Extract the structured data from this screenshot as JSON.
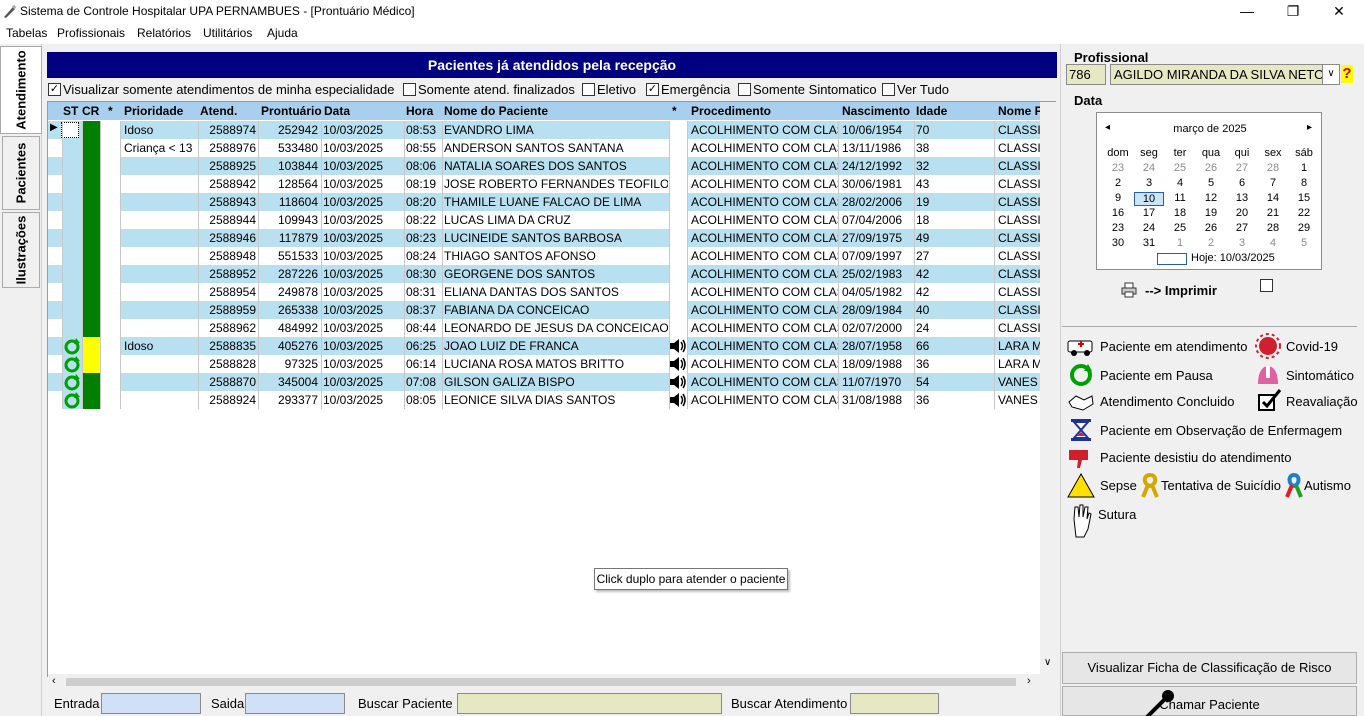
{
  "window": {
    "title": "Sistema de Controle Hospitalar UPA PERNAMBUES - [Prontuário Médico]",
    "controls": {
      "minimize": "—",
      "maximize": "❐",
      "close": "✕"
    }
  },
  "menu": [
    "Tabelas",
    "Profissionais",
    "Relatórios",
    "Utilitários",
    "Ajuda"
  ],
  "side_tabs": [
    "Atendimento",
    "Pacientes",
    "Ilustrações"
  ],
  "panel_title": "Pacientes já atendidos pela recepção",
  "filters": [
    {
      "label": "Visualizar somente atendimentos de minha especialidade",
      "checked": true
    },
    {
      "label": "Somente atend. finalizados",
      "checked": false
    },
    {
      "label": "Eletivo",
      "checked": false
    },
    {
      "label": "Emergência",
      "checked": true
    },
    {
      "label": "Somente Sintomatico",
      "checked": false
    },
    {
      "label": "Ver Tudo",
      "checked": false
    }
  ],
  "columns": [
    "ST",
    "CR",
    "*",
    "Prioridade",
    "Atend.",
    "Prontuário",
    "Data",
    "Hora",
    "Nome do Paciente",
    "*",
    "Procedimento",
    "Nascimento",
    "Idade",
    "Nome P"
  ],
  "rows": [
    {
      "st": "",
      "cr": "green",
      "prioridade": "Idoso",
      "atend": "2588974",
      "prontuario": "252942",
      "data": "10/03/2025",
      "hora": "08:53",
      "nome": "EVANDRO LIMA",
      "audio": false,
      "procedimento": "ACOLHIMENTO COM CLAS",
      "nascimento": "10/06/1954",
      "idade": "70",
      "prof": "CLASSI",
      "selected": true
    },
    {
      "st": "",
      "cr": "green",
      "prioridade": "Criança < 13",
      "atend": "2588976",
      "prontuario": "533480",
      "data": "10/03/2025",
      "hora": "08:55",
      "nome": "ANDERSON SANTOS SANTANA",
      "audio": false,
      "procedimento": "ACOLHIMENTO COM CLAS",
      "nascimento": "13/11/1986",
      "idade": "38",
      "prof": "CLASSI"
    },
    {
      "st": "",
      "cr": "green",
      "prioridade": "",
      "atend": "2588925",
      "prontuario": "103844",
      "data": "10/03/2025",
      "hora": "08:06",
      "nome": "NATALIA SOARES DOS SANTOS",
      "audio": false,
      "procedimento": "ACOLHIMENTO COM CLAS",
      "nascimento": "24/12/1992",
      "idade": "32",
      "prof": "CLASSI"
    },
    {
      "st": "",
      "cr": "green",
      "prioridade": "",
      "atend": "2588942",
      "prontuario": "128564",
      "data": "10/03/2025",
      "hora": "08:19",
      "nome": "JOSE ROBERTO FERNANDES TEOFILO",
      "audio": false,
      "procedimento": "ACOLHIMENTO COM CLAS",
      "nascimento": "30/06/1981",
      "idade": "43",
      "prof": "CLASSI"
    },
    {
      "st": "",
      "cr": "green",
      "prioridade": "",
      "atend": "2588943",
      "prontuario": "118604",
      "data": "10/03/2025",
      "hora": "08:20",
      "nome": "THAMILE LUANE FALCAO DE LIMA",
      "audio": false,
      "procedimento": "ACOLHIMENTO COM CLAS",
      "nascimento": "28/02/2006",
      "idade": "19",
      "prof": "CLASSI"
    },
    {
      "st": "",
      "cr": "green",
      "prioridade": "",
      "atend": "2588944",
      "prontuario": "109943",
      "data": "10/03/2025",
      "hora": "08:22",
      "nome": "LUCAS LIMA DA CRUZ",
      "audio": false,
      "procedimento": "ACOLHIMENTO COM CLAS",
      "nascimento": "07/04/2006",
      "idade": "18",
      "prof": "CLASSI"
    },
    {
      "st": "",
      "cr": "green",
      "prioridade": "",
      "atend": "2588946",
      "prontuario": "117879",
      "data": "10/03/2025",
      "hora": "08:23",
      "nome": "LUCINEIDE SANTOS BARBOSA",
      "audio": false,
      "procedimento": "ACOLHIMENTO COM CLAS",
      "nascimento": "27/09/1975",
      "idade": "49",
      "prof": "CLASSI"
    },
    {
      "st": "",
      "cr": "green",
      "prioridade": "",
      "atend": "2588948",
      "prontuario": "551533",
      "data": "10/03/2025",
      "hora": "08:24",
      "nome": "THIAGO SANTOS AFONSO",
      "audio": false,
      "procedimento": "ACOLHIMENTO COM CLAS",
      "nascimento": "07/09/1997",
      "idade": "27",
      "prof": "CLASSI"
    },
    {
      "st": "",
      "cr": "green",
      "prioridade": "",
      "atend": "2588952",
      "prontuario": "287226",
      "data": "10/03/2025",
      "hora": "08:30",
      "nome": "GEORGENE DOS SANTOS",
      "audio": false,
      "procedimento": "ACOLHIMENTO COM CLAS",
      "nascimento": "25/02/1983",
      "idade": "42",
      "prof": "CLASSI"
    },
    {
      "st": "",
      "cr": "green",
      "prioridade": "",
      "atend": "2588954",
      "prontuario": "249878",
      "data": "10/03/2025",
      "hora": "08:31",
      "nome": "ELIANA DANTAS DOS SANTOS",
      "audio": false,
      "procedimento": "ACOLHIMENTO COM CLAS",
      "nascimento": "04/05/1982",
      "idade": "42",
      "prof": "CLASSI"
    },
    {
      "st": "",
      "cr": "green",
      "prioridade": "",
      "atend": "2588959",
      "prontuario": "265338",
      "data": "10/03/2025",
      "hora": "08:37",
      "nome": "FABIANA DA CONCEICAO",
      "audio": false,
      "procedimento": "ACOLHIMENTO COM CLAS",
      "nascimento": "28/09/1984",
      "idade": "40",
      "prof": "CLASSI"
    },
    {
      "st": "",
      "cr": "green",
      "prioridade": "",
      "atend": "2588962",
      "prontuario": "484992",
      "data": "10/03/2025",
      "hora": "08:44",
      "nome": "LEONARDO DE JESUS DA CONCEICAO",
      "audio": false,
      "procedimento": "ACOLHIMENTO COM CLAS",
      "nascimento": "02/07/2000",
      "idade": "24",
      "prof": "CLASSI"
    },
    {
      "st": "pause",
      "cr": "yellow",
      "prioridade": "Idoso",
      "atend": "2588835",
      "prontuario": "405276",
      "data": "10/03/2025",
      "hora": "06:25",
      "nome": "JOAO LUIZ DE FRANCA",
      "audio": true,
      "procedimento": "ACOLHIMENTO COM CLAS",
      "nascimento": "28/07/1958",
      "idade": "66",
      "prof": "LARA M"
    },
    {
      "st": "pause",
      "cr": "yellow",
      "prioridade": "",
      "atend": "2588828",
      "prontuario": "97325",
      "data": "10/03/2025",
      "hora": "06:14",
      "nome": "LUCIANA ROSA MATOS BRITTO",
      "audio": true,
      "procedimento": "ACOLHIMENTO COM CLAS",
      "nascimento": "18/09/1988",
      "idade": "36",
      "prof": "LARA M"
    },
    {
      "st": "pause",
      "cr": "green",
      "prioridade": "",
      "atend": "2588870",
      "prontuario": "345004",
      "data": "10/03/2025",
      "hora": "07:08",
      "nome": "GILSON GALIZA BISPO",
      "audio": true,
      "procedimento": "ACOLHIMENTO COM CLAS",
      "nascimento": "11/07/1970",
      "idade": "54",
      "prof": "VANES"
    },
    {
      "st": "pause",
      "cr": "green",
      "prioridade": "",
      "atend": "2588924",
      "prontuario": "293377",
      "data": "10/03/2025",
      "hora": "08:05",
      "nome": "LEONICE SILVA DIAS SANTOS",
      "audio": true,
      "procedimento": "ACOLHIMENTO COM CLAS",
      "nascimento": "31/08/1988",
      "idade": "36",
      "prof": "VANES"
    }
  ],
  "tooltip": "Click duplo para atender o paciente",
  "bottom": {
    "entrada_label": "Entrada",
    "saida_label": "Saida",
    "buscar_paciente_label": "Buscar Paciente",
    "buscar_atendimento_label": "Buscar Atendimento"
  },
  "profissional": {
    "label": "Profissional",
    "code": "786",
    "name": "AGILDO MIRANDA DA SILVA NETO",
    "help": "?"
  },
  "data_label": "Data",
  "calendar": {
    "month": "março de 2025",
    "weekdays": [
      "dom",
      "seg",
      "ter",
      "qua",
      "qui",
      "sex",
      "sáb"
    ],
    "days": [
      [
        "23",
        "24",
        "25",
        "26",
        "27",
        "28",
        "1"
      ],
      [
        "2",
        "3",
        "4",
        "5",
        "6",
        "7",
        "8"
      ],
      [
        "9",
        "10",
        "11",
        "12",
        "13",
        "14",
        "15"
      ],
      [
        "16",
        "17",
        "18",
        "19",
        "20",
        "21",
        "22"
      ],
      [
        "23",
        "24",
        "25",
        "26",
        "27",
        "28",
        "29"
      ],
      [
        "30",
        "31",
        "1",
        "2",
        "3",
        "4",
        "5"
      ]
    ],
    "selected": "10",
    "today_label": "Hoje: 10/03/2025"
  },
  "imprimir_label": "--> Imprimir",
  "legend": {
    "em_atendimento": "Paciente em atendimento",
    "covid": "Covid-19",
    "pausa": "Paciente em Pausa",
    "sintomatico": "Sintomático",
    "concluido": "Atendimento Concluido",
    "reavaliacao": "Reavaliação",
    "observacao": "Paciente em Observação de Enfermagem",
    "desistiu": "Paciente desistiu do atendimento",
    "sepse": "Sepse",
    "suicidio": "Tentativa de Suicídio",
    "autismo": "Autismo",
    "sutura": "Sutura"
  },
  "buttons": {
    "ficha": "Visualizar Ficha de Classificação de Risco",
    "chamar": "Chamar Paciente"
  },
  "colors": {
    "header_navy": "#000080",
    "row_blue": "#b8e0f0",
    "cr_green": "#008000",
    "cr_yellow": "#ffff00",
    "st_pause_green": "#00a000"
  }
}
